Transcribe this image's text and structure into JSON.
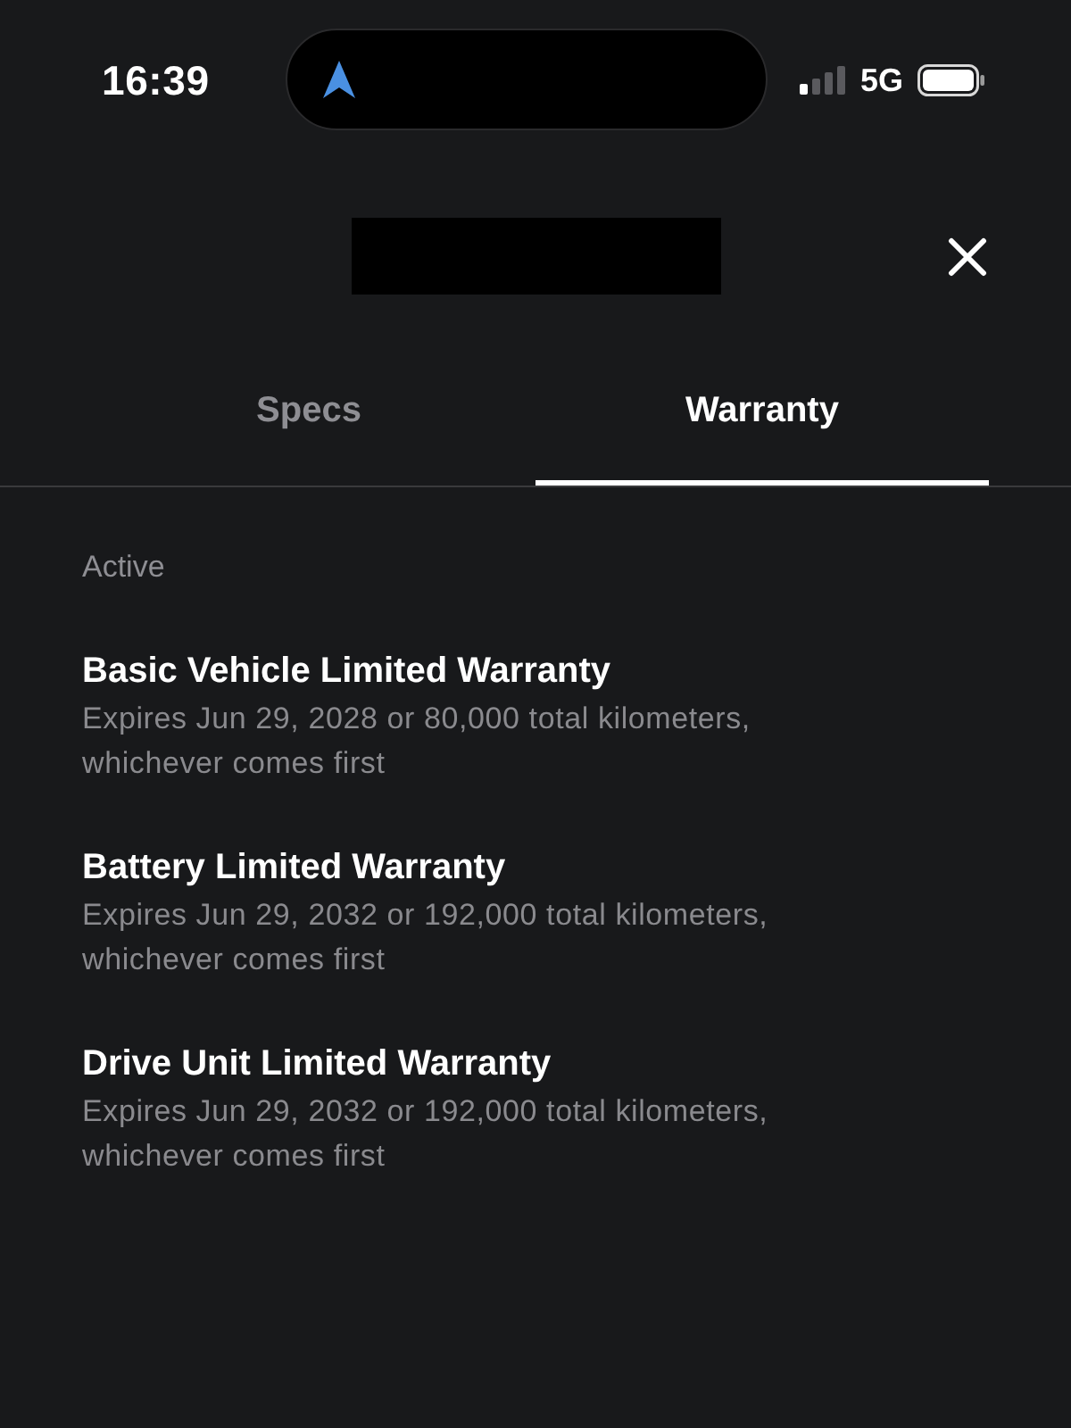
{
  "status_bar": {
    "time": "16:39",
    "network": "5G"
  },
  "tabs": [
    {
      "label": "Specs",
      "selected": false
    },
    {
      "label": "Warranty",
      "selected": true
    }
  ],
  "section": {
    "title": "Active",
    "warranties": [
      {
        "name": "Basic Vehicle Limited Warranty",
        "terms": "Expires Jun 29, 2028 or 80,000 total kilometers, whichever comes first"
      },
      {
        "name": "Battery Limited Warranty",
        "terms": "Expires Jun 29, 2032 or 192,000 total kilometers, whichever comes first"
      },
      {
        "name": "Drive Unit Limited Warranty",
        "terms": "Expires Jun 29, 2032 or 192,000 total kilometers, whichever comes first"
      }
    ]
  }
}
